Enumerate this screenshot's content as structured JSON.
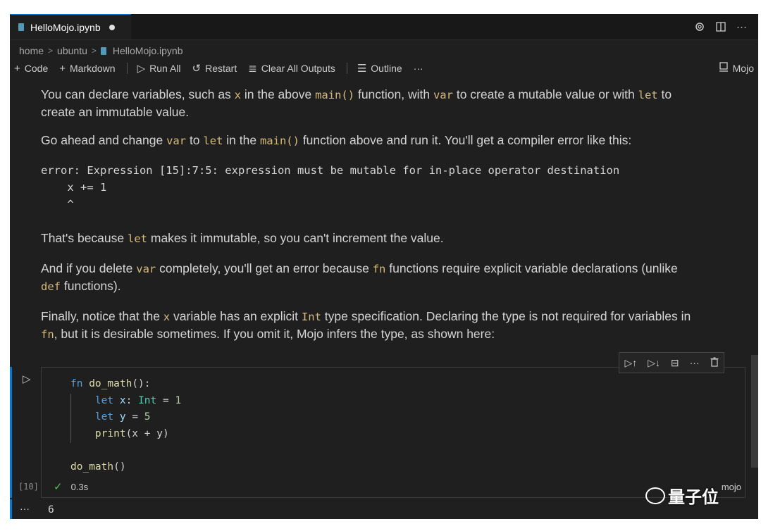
{
  "tab": {
    "filename": "HelloMojo.ipynb"
  },
  "breadcrumb": {
    "items": [
      "home",
      "ubuntu",
      "HelloMojo.ipynb"
    ]
  },
  "toolbar": {
    "code_label": "Code",
    "markdown_label": "Markdown",
    "run_all_label": "Run All",
    "restart_label": "Restart",
    "clear_outputs_label": "Clear All Outputs",
    "outline_label": "Outline",
    "more_label": "···",
    "kernel_label": "Mojo"
  },
  "markdown": {
    "p1": {
      "a": "You can declare variables, such as ",
      "c1": "x",
      "b": " in the above ",
      "c2": "main()",
      "c": " function, with ",
      "c3": "var",
      "d": " to create a mutable value or with ",
      "c4": "let",
      "e": " to",
      "f": "create an immutable value."
    },
    "p2": {
      "a": "Go ahead and change ",
      "c1": "var",
      "b": " to ",
      "c2": "let",
      "c": " in the ",
      "c3": "main()",
      "d": " function above and run it. You'll get a compiler error like this:"
    },
    "error_block": {
      "line1": "error: Expression [15]:7:5: expression must be mutable for in-place operator destination",
      "line2": "    x += 1",
      "line3": "    ^"
    },
    "p3": {
      "a": "That's because ",
      "c1": "let",
      "b": " makes it immutable, so you can't increment the value."
    },
    "p4": {
      "a": "And if you delete ",
      "c1": "var",
      "b": " completely, you'll get an error because ",
      "c2": "fn",
      "c": " functions require explicit variable declarations (unlike",
      "c3": "def",
      "d": " functions)."
    },
    "p5": {
      "a": "Finally, notice that the ",
      "c1": "x",
      "b": " variable has an explicit ",
      "c2": "Int",
      "c": " type specification. Declaring the type is not required for variables in",
      "c3": "fn",
      "d": ", but it is desirable sometimes. If you omit it, Mojo infers the type, as shown here:"
    }
  },
  "cell": {
    "code": {
      "l1_kw": "fn",
      "l1_name": "do_math",
      "l1_rest": "():",
      "l2_kw": "let",
      "l2_var": "x",
      "l2_colon": ": ",
      "l2_type": "Int",
      "l2_eq": " = ",
      "l2_num": "1",
      "l3_kw": "let",
      "l3_var": "y",
      "l3_eq": " = ",
      "l3_num": "5",
      "l4_fn": "print",
      "l4_rest": "(x + y)",
      "l6_call": "do_math",
      "l6_rest": "()"
    },
    "execution_count": "[10]",
    "duration": "0.3s",
    "language": "mojo",
    "output_ellipsis": "···",
    "output": "6"
  },
  "watermark": {
    "text": "量子位"
  },
  "colors": {
    "accent": "#0078d4",
    "inline_code": "#d7ba7d",
    "background": "#1f1f1f"
  }
}
